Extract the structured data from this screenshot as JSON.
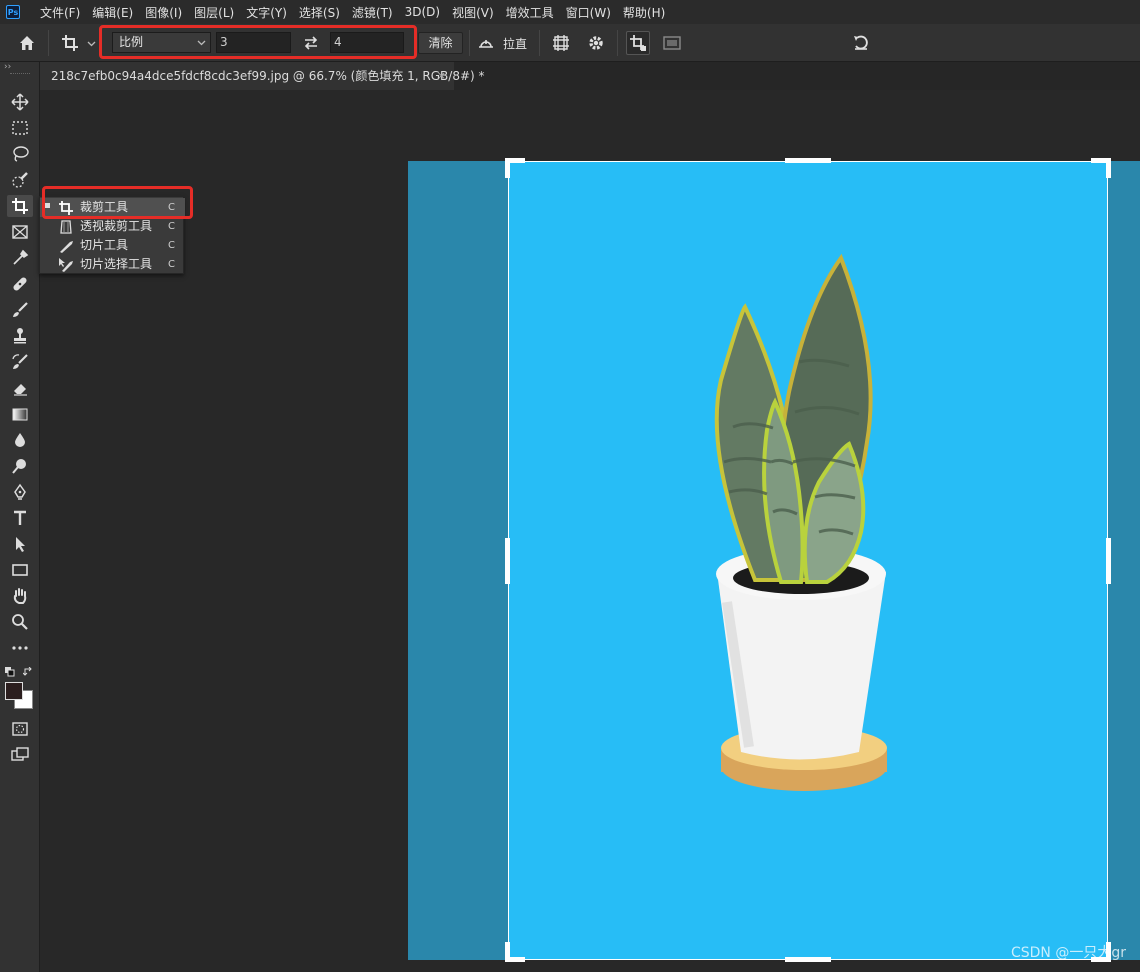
{
  "menubar": {
    "logo": "Ps",
    "items": [
      "文件(F)",
      "编辑(E)",
      "图像(I)",
      "图层(L)",
      "文字(Y)",
      "选择(S)",
      "滤镜(T)",
      "3D(D)",
      "视图(V)",
      "增效工具",
      "窗口(W)",
      "帮助(H)"
    ]
  },
  "options": {
    "ratio_select": "比例",
    "width_value": "3",
    "height_value": "4",
    "clear_button": "清除",
    "straighten_label": "拉直"
  },
  "document": {
    "tab_title": "218c7efb0c94a4dce5fdcf8cdc3ef99.jpg @ 66.7% (颜色填充 1, RGB/8#) *",
    "tab_close": "×"
  },
  "flyout": {
    "items": [
      {
        "label": "裁剪工具",
        "key": "C",
        "icon": "crop-icon",
        "selected": true
      },
      {
        "label": "透视裁剪工具",
        "key": "C",
        "icon": "perspective-crop-icon",
        "selected": false
      },
      {
        "label": "切片工具",
        "key": "C",
        "icon": "slice-icon",
        "selected": false
      },
      {
        "label": "切片选择工具",
        "key": "C",
        "icon": "slice-select-icon",
        "selected": false
      }
    ]
  },
  "watermark": "CSDN @一只大gr",
  "colors": {
    "canvas_bg": "#2a87ab",
    "crop_area": "#27bdf6",
    "highlight": "#e52d27",
    "foreground_swatch": "#2b1e1e",
    "background_swatch": "#ffffff"
  }
}
